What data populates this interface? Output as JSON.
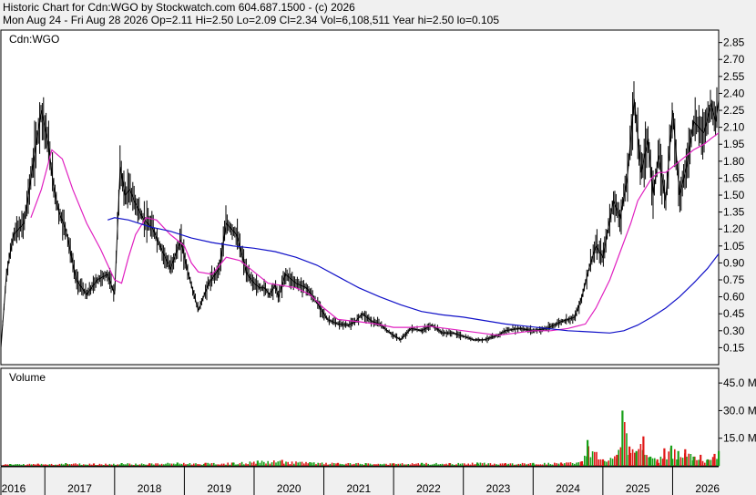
{
  "header": {
    "title": "Historic Chart for Cdn:WGO by Stockwatch.com 604.687.1500 - (c) 2026",
    "info": "Mon Aug 24 - Fri Aug 28 2026   Op=2.11   Hi=2.50   Lo=2.09   Cl=2.34   Vol=6,108,511   Year hi=2.50   lo=0.105"
  },
  "price_panel": {
    "label": "Cdn:WGO"
  },
  "volume_panel": {
    "label": "Volume"
  },
  "colors": {
    "background": "#f0f0f0",
    "plot_bg": "#ffffff",
    "price": "#000000",
    "ma_short": "#e020c0",
    "ma_long": "#1010c8",
    "vol_up": "#18a018",
    "vol_down": "#e01818",
    "grid": "#d8d8d8"
  },
  "chart_data": [
    {
      "type": "line",
      "panel": "price",
      "title": "Historic Chart for Cdn:WGO by Stockwatch.com 604.687.1500 - (c) 2026",
      "x_axis": {
        "labels": [
          "2016",
          "2017",
          "2018",
          "2019",
          "2020",
          "2021",
          "2022",
          "2023",
          "2024",
          "2025",
          "2026"
        ],
        "start_year": 2016.37,
        "end_year": 2026.66
      },
      "y_axis": {
        "ticks": [
          "0.15",
          "0.30",
          "0.45",
          "0.60",
          "0.75",
          "0.90",
          "1.05",
          "1.20",
          "1.35",
          "1.50",
          "1.65",
          "1.80",
          "1.95",
          "2.10",
          "2.25",
          "2.40",
          "2.55",
          "2.70",
          "2.85"
        ],
        "ylim": [
          0.0,
          2.96
        ],
        "position": "right"
      },
      "grid": false,
      "series": [
        {
          "role": "price",
          "x": [
            2016.37,
            2016.45,
            2016.55,
            2016.7,
            2016.85,
            2016.95,
            2017.05,
            2017.12,
            2017.2,
            2017.3,
            2017.45,
            2017.6,
            2017.75,
            2017.9,
            2018.0,
            2018.08,
            2018.15,
            2018.22,
            2018.28,
            2018.4,
            2018.55,
            2018.65,
            2018.8,
            2018.95,
            2019.05,
            2019.2,
            2019.35,
            2019.5,
            2019.6,
            2019.75,
            2019.9,
            2020.0,
            2020.08,
            2020.15,
            2020.22,
            2020.3,
            2020.35,
            2020.45,
            2020.6,
            2020.75,
            2020.9,
            2021.05,
            2021.2,
            2021.35,
            2021.45,
            2021.55,
            2021.7,
            2021.8,
            2021.95,
            2022.1,
            2022.25,
            2022.4,
            2022.55,
            2022.7,
            2022.85,
            2023.0,
            2023.15,
            2023.3,
            2023.5,
            2023.6,
            2023.8,
            2024.0,
            2024.2,
            2024.4,
            2024.6,
            2024.7,
            2024.8,
            2024.9,
            2025.0,
            2025.15,
            2025.25,
            2025.35,
            2025.45,
            2025.55,
            2025.65,
            2025.72,
            2025.8,
            2025.9,
            2026.0,
            2026.1,
            2026.2,
            2026.3,
            2026.45,
            2026.55,
            2026.62,
            2026.66
          ],
          "y": [
            0.15,
            0.8,
            1.15,
            1.25,
            1.85,
            2.25,
            1.95,
            1.6,
            1.35,
            1.2,
            0.75,
            0.62,
            0.75,
            0.8,
            0.62,
            1.75,
            1.5,
            1.55,
            1.45,
            1.3,
            1.2,
            1.05,
            0.85,
            1.1,
            0.82,
            0.48,
            0.72,
            0.85,
            1.25,
            1.15,
            0.8,
            0.72,
            0.68,
            0.68,
            0.62,
            0.7,
            0.6,
            0.8,
            0.72,
            0.68,
            0.55,
            0.4,
            0.36,
            0.35,
            0.38,
            0.45,
            0.38,
            0.36,
            0.28,
            0.22,
            0.32,
            0.3,
            0.35,
            0.28,
            0.28,
            0.25,
            0.22,
            0.22,
            0.26,
            0.3,
            0.32,
            0.3,
            0.32,
            0.38,
            0.42,
            0.6,
            0.85,
            1.05,
            0.95,
            1.45,
            1.3,
            1.65,
            2.35,
            1.7,
            2.0,
            1.5,
            1.85,
            1.45,
            2.25,
            1.5,
            1.75,
            2.15,
            2.05,
            2.3,
            2.15,
            2.34
          ]
        },
        {
          "role": "moving_average_short",
          "x": [
            2016.8,
            2016.95,
            2017.1,
            2017.25,
            2017.4,
            2017.6,
            2017.8,
            2018.0,
            2018.1,
            2018.2,
            2018.3,
            2018.45,
            2018.6,
            2018.8,
            2019.0,
            2019.1,
            2019.2,
            2019.4,
            2019.6,
            2019.8,
            2020.0,
            2020.2,
            2020.4,
            2020.6,
            2020.8,
            2021.0,
            2021.2,
            2021.5,
            2021.75,
            2022.0,
            2022.25,
            2022.5,
            2022.75,
            2023.0,
            2023.25,
            2023.5,
            2023.75,
            2024.0,
            2024.25,
            2024.5,
            2024.75,
            2024.9,
            2025.1,
            2025.25,
            2025.4,
            2025.5,
            2025.6,
            2025.7,
            2025.8,
            2025.9,
            2026.0,
            2026.1,
            2026.2,
            2026.3,
            2026.45,
            2026.55,
            2026.66
          ],
          "y": [
            1.3,
            1.55,
            1.9,
            1.82,
            1.55,
            1.25,
            1.02,
            0.75,
            0.72,
            0.95,
            1.15,
            1.3,
            1.28,
            1.15,
            1.05,
            0.9,
            0.82,
            0.8,
            0.95,
            0.92,
            0.82,
            0.72,
            0.7,
            0.68,
            0.62,
            0.5,
            0.4,
            0.38,
            0.36,
            0.33,
            0.33,
            0.34,
            0.32,
            0.3,
            0.28,
            0.26,
            0.28,
            0.3,
            0.3,
            0.32,
            0.36,
            0.5,
            0.75,
            1.0,
            1.25,
            1.45,
            1.55,
            1.65,
            1.7,
            1.7,
            1.75,
            1.8,
            1.85,
            1.9,
            1.95,
            2.0,
            2.05
          ]
        },
        {
          "role": "moving_average_long",
          "x": [
            2017.9,
            2018.0,
            2018.2,
            2018.5,
            2018.8,
            2019.1,
            2019.4,
            2019.7,
            2020.0,
            2020.3,
            2020.6,
            2020.9,
            2021.2,
            2021.5,
            2021.8,
            2022.1,
            2022.4,
            2022.7,
            2023.0,
            2023.3,
            2023.6,
            2023.9,
            2024.2,
            2024.5,
            2024.8,
            2025.1,
            2025.3,
            2025.5,
            2025.7,
            2025.9,
            2026.1,
            2026.3,
            2026.5,
            2026.66
          ],
          "y": [
            1.28,
            1.3,
            1.28,
            1.22,
            1.18,
            1.12,
            1.08,
            1.05,
            1.03,
            1.0,
            0.95,
            0.88,
            0.78,
            0.68,
            0.6,
            0.53,
            0.47,
            0.44,
            0.42,
            0.39,
            0.36,
            0.34,
            0.32,
            0.3,
            0.29,
            0.28,
            0.3,
            0.35,
            0.42,
            0.5,
            0.6,
            0.72,
            0.85,
            0.98
          ]
        }
      ]
    },
    {
      "type": "bar",
      "panel": "volume",
      "title": "Volume",
      "y_axis": {
        "ticks": [
          "15.0 M",
          "30.0 M",
          "45.0 M"
        ],
        "ylim": [
          0,
          53
        ],
        "unit": "M",
        "position": "right"
      },
      "x": [
        2016.5,
        2016.9,
        2017.3,
        2017.7,
        2018.1,
        2018.5,
        2018.9,
        2019.3,
        2019.7,
        2020.05,
        2020.4,
        2020.8,
        2021.2,
        2021.6,
        2022.0,
        2022.4,
        2022.8,
        2023.2,
        2023.6,
        2024.0,
        2024.4,
        2024.7,
        2024.78,
        2025.0,
        2025.2,
        2025.28,
        2025.38,
        2025.48,
        2025.58,
        2025.68,
        2025.78,
        2025.88,
        2025.98,
        2026.08,
        2026.18,
        2026.3,
        2026.4,
        2026.5,
        2026.6,
        2026.66
      ],
      "values": [
        1.0,
        1.2,
        1.5,
        1.3,
        1.5,
        1.4,
        1.8,
        1.6,
        1.8,
        2.8,
        3.2,
        2.0,
        1.6,
        1.5,
        1.4,
        1.6,
        1.5,
        1.8,
        1.5,
        1.6,
        1.8,
        2.5,
        14.0,
        3.5,
        6.0,
        30.0,
        10.5,
        8.0,
        16.0,
        5.0,
        3.5,
        9.5,
        11.0,
        8.0,
        9.0,
        5.0,
        6.0,
        3.5,
        6.5,
        8.0
      ],
      "up": [
        true,
        false,
        true,
        false,
        true,
        false,
        true,
        false,
        true,
        true,
        false,
        true,
        false,
        true,
        false,
        true,
        false,
        true,
        false,
        true,
        false,
        false,
        true,
        false,
        false,
        true,
        false,
        true,
        false,
        true,
        false,
        false,
        true,
        true,
        false,
        true,
        false,
        true,
        false,
        true
      ]
    }
  ]
}
